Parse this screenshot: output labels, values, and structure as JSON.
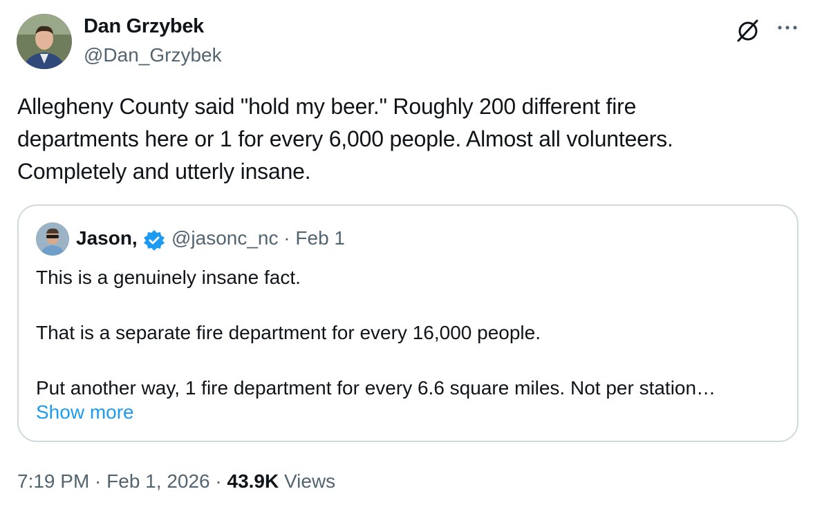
{
  "author": {
    "name": "Dan Grzybek",
    "handle": "@Dan_Grzybek"
  },
  "icons": {
    "grok": "grok-icon",
    "more": "more-horizontal-icon",
    "verified": "verified-badge-icon"
  },
  "tweet": {
    "text": "Allegheny County said \"hold my beer.\" Roughly 200 different fire\ndepartments here or 1 for every 6,000 people. Almost all volunteers.\nCompletely and utterly insane."
  },
  "quote": {
    "name": "Jason,",
    "handle_date": "@jasonc_nc · Feb 1",
    "text": "This is a genuinely insane fact.\n\nThat is a separate fire department for every 16,000 people.\n\nPut another way, 1 fire department for every 6.6 square miles. Not per station…",
    "show_more": "Show more"
  },
  "meta": {
    "time_date": "7:19 PM · Feb 1, 2026 · ",
    "views_count": "43.9K",
    "views_label": " Views"
  },
  "colors": {
    "text": "#0f1419",
    "secondary": "#536471",
    "link": "#1d9bf0",
    "border": "#cfd9de"
  }
}
